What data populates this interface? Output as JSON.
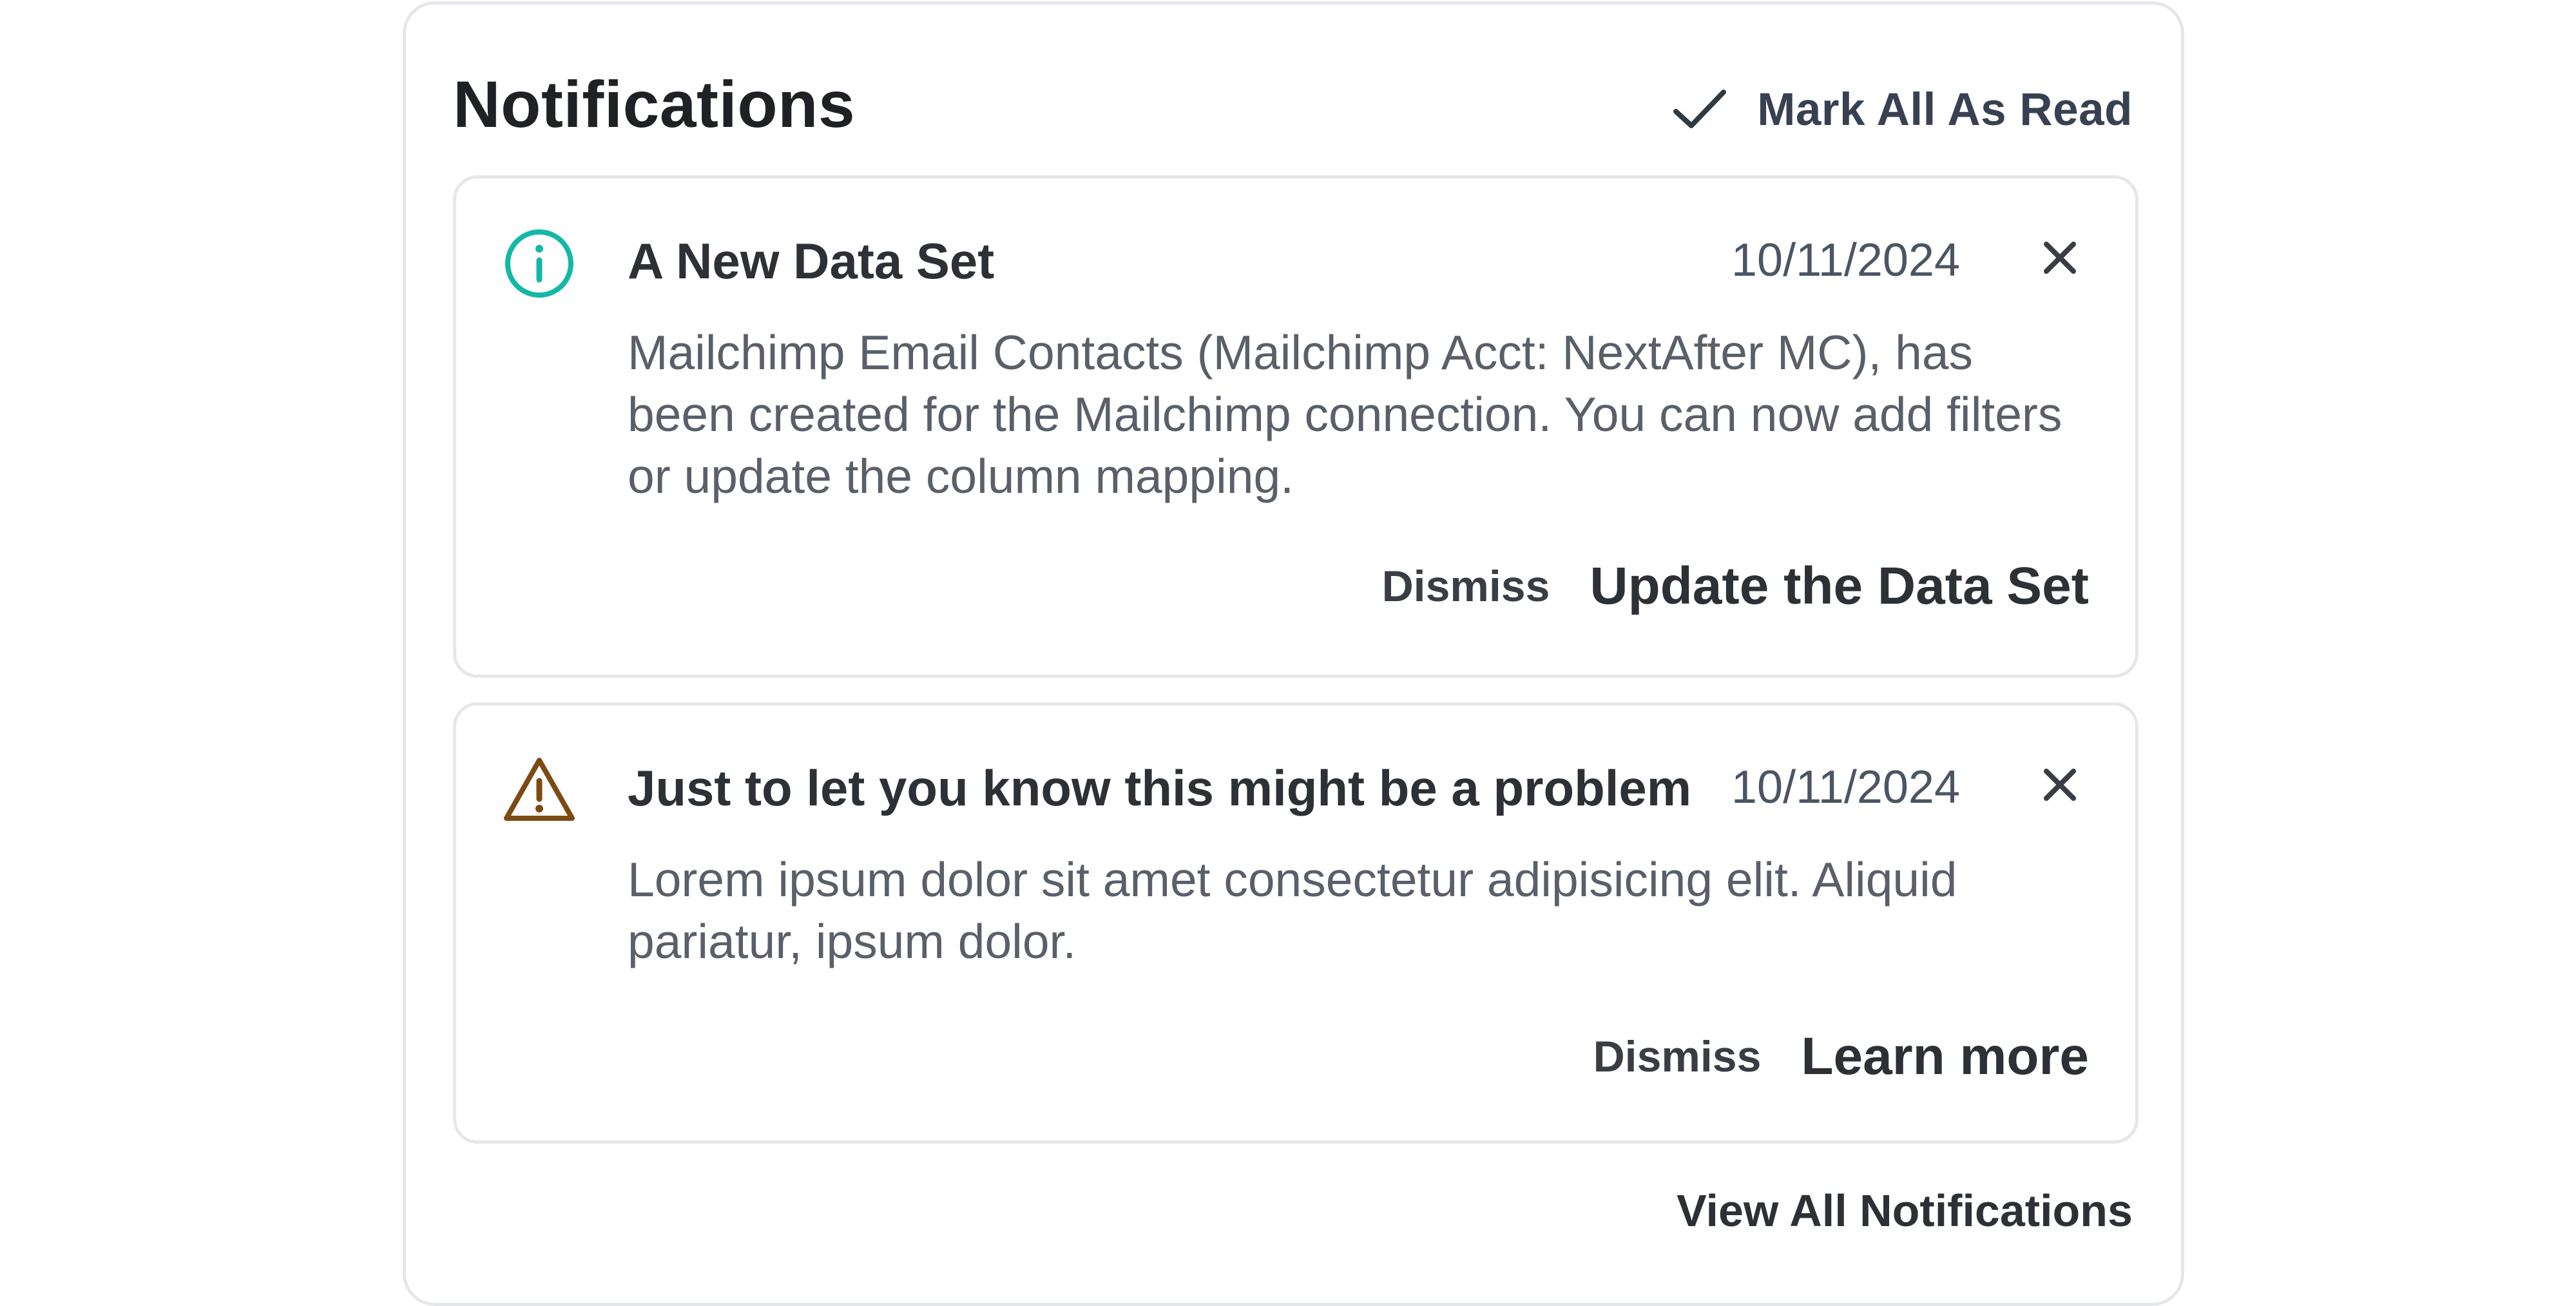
{
  "header": {
    "title": "Notifications",
    "mark_all_label": "Mark All As Read"
  },
  "notifications": [
    {
      "type": "info",
      "title": "A New Data Set",
      "date": "10/11/2024",
      "body": "Mailchimp Email Contacts (Mailchimp Acct: NextAfter MC), has been created for the Mailchimp connection. You can now add filters or update the column mapping.",
      "dismiss_label": "Dismiss",
      "action_label": "Update the Data Set"
    },
    {
      "type": "warning",
      "title": "Just to let you know this might be a problem",
      "date": "10/11/2024",
      "body": "Lorem ipsum dolor sit amet consectetur adipisicing elit. Aliquid pariatur, ipsum dolor.",
      "dismiss_label": "Dismiss",
      "action_label": "Learn more"
    }
  ],
  "footer": {
    "view_all_label": "View All Notifications"
  },
  "colors": {
    "info_icon": "#14b8a6",
    "warning_icon": "#7c4a12",
    "text_primary": "#1f2124",
    "text_secondary": "#5a5f69",
    "border": "#e5e7eb"
  },
  "icons": {
    "mark_all": "check-icon",
    "info": "info-circle-icon",
    "warning": "warning-triangle-icon",
    "close": "close-icon"
  }
}
